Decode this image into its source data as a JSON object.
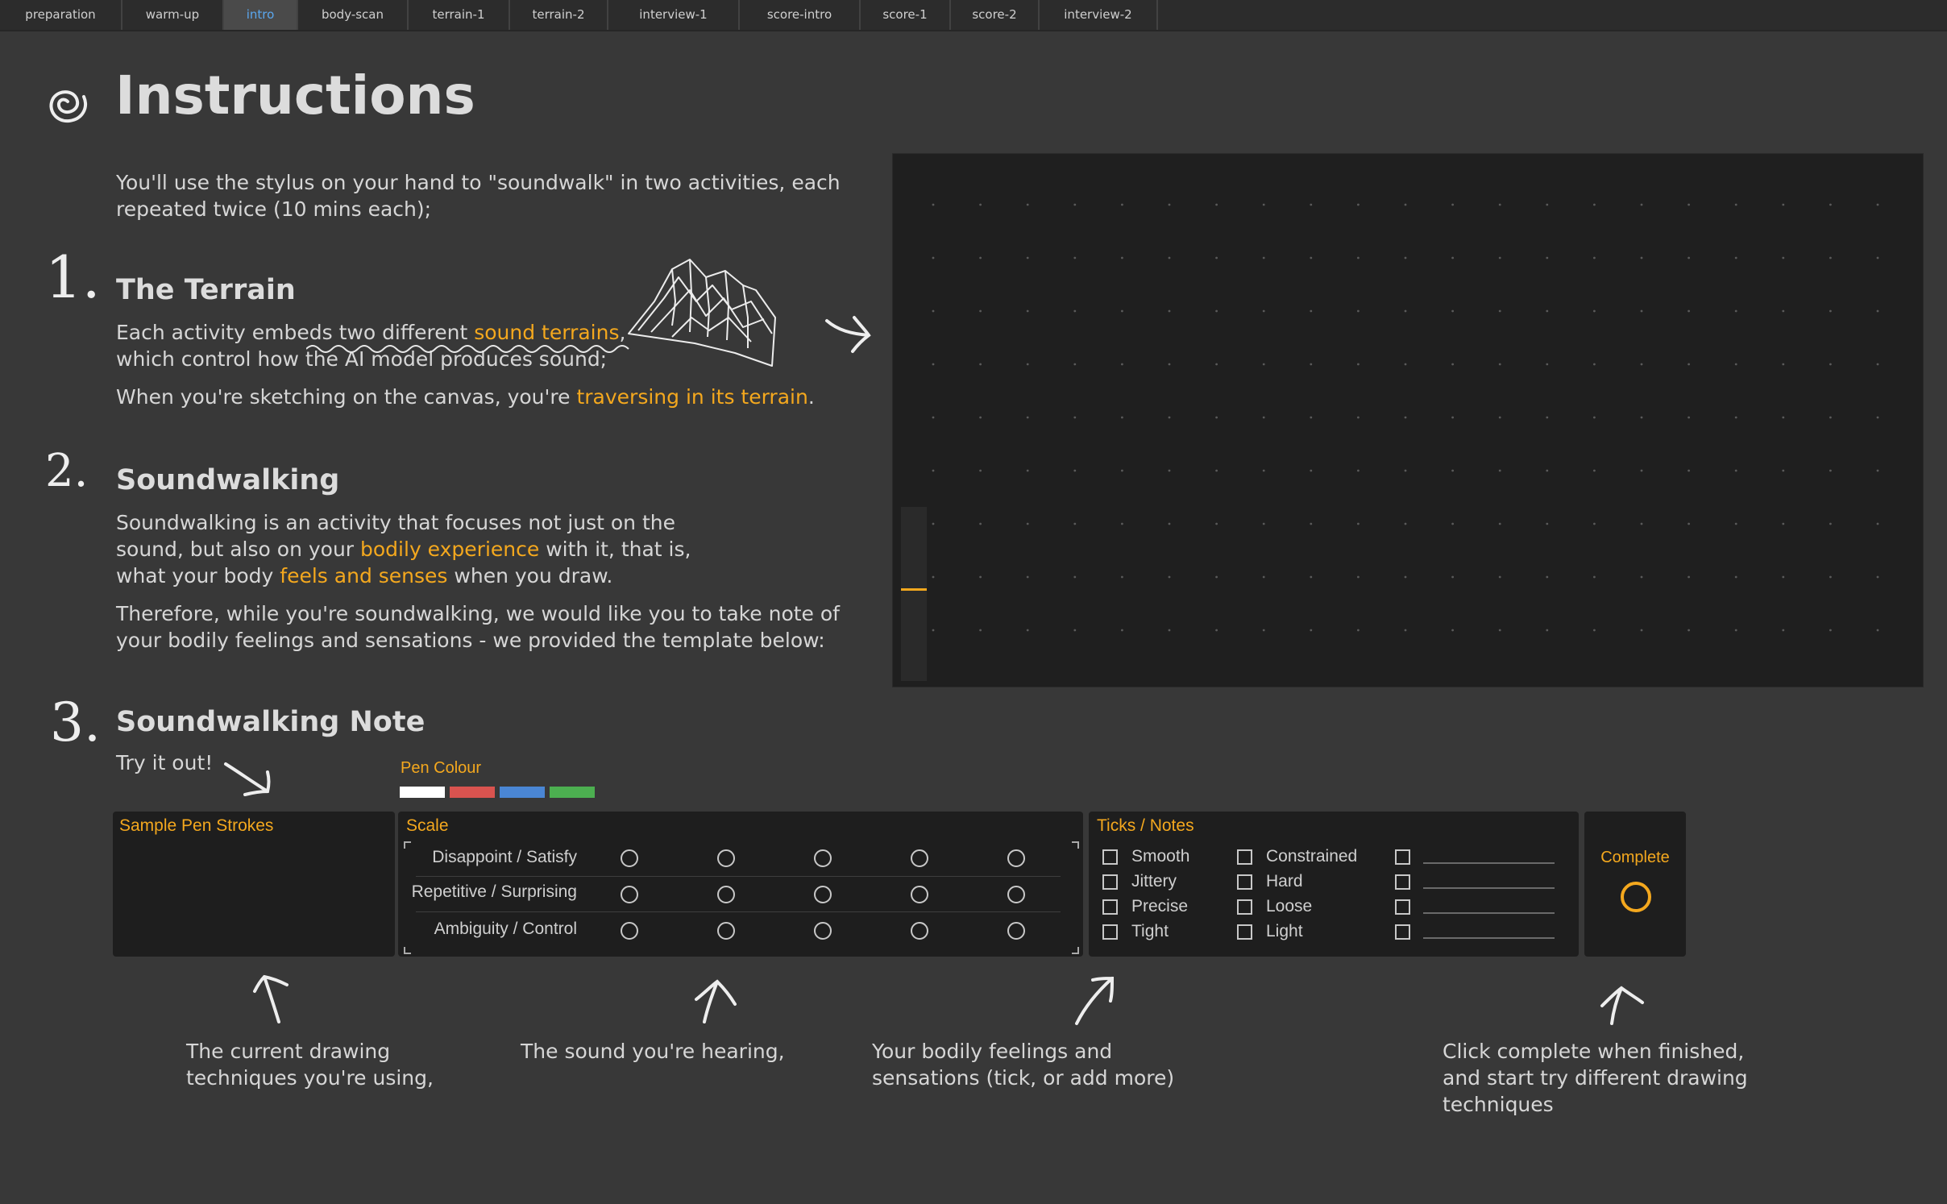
{
  "tabs": [
    "preparation",
    "warm-up",
    "intro",
    "body-scan",
    "terrain-1",
    "terrain-2",
    "interview-1",
    "score-intro",
    "score-1",
    "score-2",
    "interview-2"
  ],
  "active_tab": "intro",
  "page_title": "Instructions",
  "intro_line1": "You'll use the stylus on your hand to \"soundwalk\" in two activities, each",
  "intro_line2": "repeated twice (10 mins each);",
  "s1": {
    "num": "1.",
    "title": "The Terrain",
    "l1a": "Each activity embeds two different ",
    "l1b": "sound terrains",
    "l1c": ",",
    "l2": "which control how the AI model produces sound;",
    "l3a": "When you're sketching on the canvas, you're ",
    "l3b": "traversing in its terrain",
    "l3c": "."
  },
  "s2": {
    "num": "2.",
    "title": "Soundwalking",
    "l1": "Soundwalking is an activity that focuses not just on the",
    "l2a": "sound, but also on your ",
    "l2b": "bodily experience",
    "l2c": " with it, that is,",
    "l3a": "what your body ",
    "l3b": "feels and senses",
    "l3c": " when you draw.",
    "l4": "Therefore, while you're soundwalking, we would like you to take note of",
    "l5": "your bodily feelings and sensations - we provided the template below:"
  },
  "s3": {
    "num": "3.",
    "title": "Soundwalking Note",
    "try": "Try it out!"
  },
  "pen": {
    "label": "Pen Colour",
    "colors": [
      "#ffffff",
      "#d9534f",
      "#4a86d4",
      "#4caf50"
    ]
  },
  "sample_panel": {
    "title": "Sample Pen Strokes"
  },
  "scale_panel": {
    "title": "Scale",
    "rows": [
      "Disappoint / Satisfy",
      "Repetitive / Surprising",
      "Ambiguity / Control"
    ],
    "points": 5
  },
  "ticks_panel": {
    "title": "Ticks / Notes",
    "col1": [
      "Smooth",
      "Jittery",
      "Precise",
      "Tight"
    ],
    "col2": [
      "Constrained",
      "Hard",
      "Loose",
      "Light"
    ]
  },
  "complete": {
    "label": "Complete"
  },
  "captions": {
    "c1a": "The current drawing",
    "c1b": "techniques you're using,",
    "c2": "The sound you're hearing,",
    "c3a": "Your bodily feelings and",
    "c3b": "sensations (tick, or add more)",
    "c4a": "Click complete when finished,",
    "c4b": "and start try different drawing",
    "c4c": "techniques"
  },
  "colors": {
    "accent": "#f4a81e",
    "active_tab_text": "#5aa7ee",
    "background": "#383838",
    "panel": "#1e1e1e"
  }
}
